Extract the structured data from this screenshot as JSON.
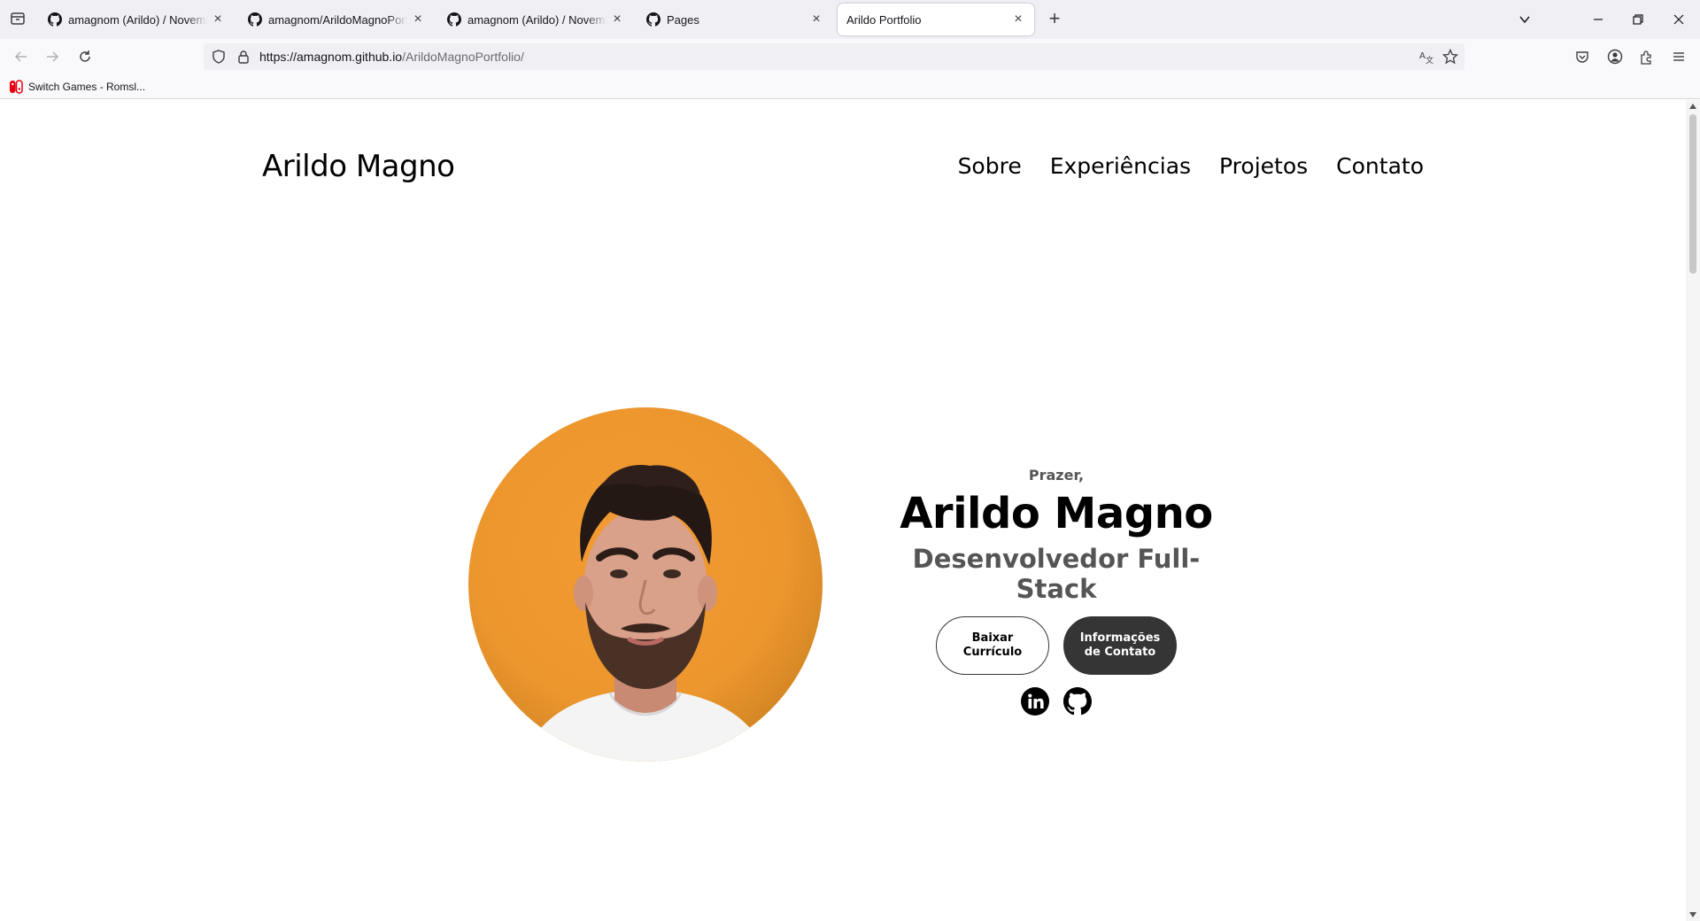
{
  "browser": {
    "tabs": [
      {
        "title": "amagnom (Arildo) / November",
        "active": false
      },
      {
        "title": "amagnom/ArildoMagnoPortfolio",
        "active": false
      },
      {
        "title": "amagnom (Arildo) / November",
        "active": false
      },
      {
        "title": "Pages",
        "active": false
      },
      {
        "title": "Arildo Portfolio",
        "active": true
      }
    ],
    "url_host": "https://amagnom.github.io",
    "url_path": "/ArildoMagnoPortfolio/",
    "bookmark": "Switch Games - Romsl..."
  },
  "site": {
    "logo": "Arildo Magno",
    "nav": [
      "Sobre",
      "Experiências",
      "Projetos",
      "Contato"
    ]
  },
  "hero": {
    "greeting": "Prazer,",
    "name": "Arildo Magno",
    "role": "Desenvolvedor Full-Stack",
    "download_cv": "Baixar Currículo",
    "contact_info": "Informações de Contato",
    "socials": [
      "linkedin-icon",
      "github-icon"
    ]
  },
  "colors": {
    "photo_background": "#ec962e",
    "button_dark": "#353535",
    "subtitle_gray": "#555555"
  }
}
